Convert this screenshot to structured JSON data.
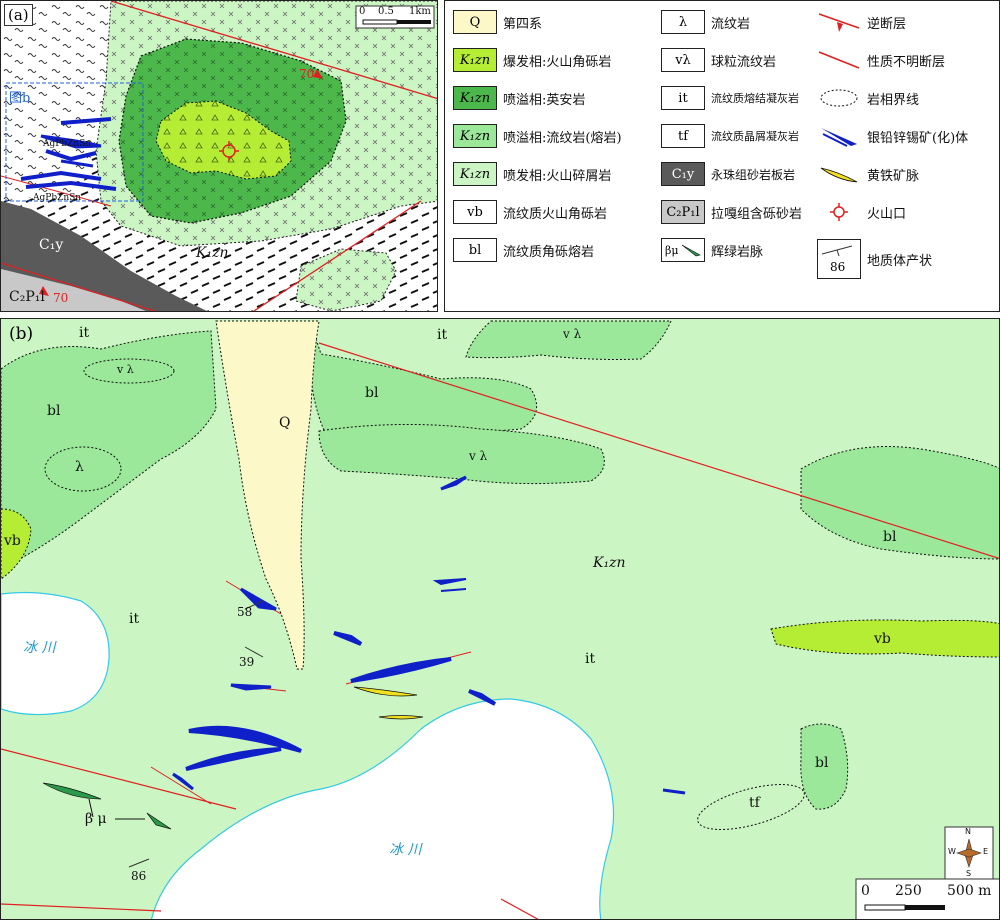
{
  "map_a": {
    "panel_label": "(a)",
    "scale": {
      "ticks": [
        "0",
        "0.5",
        "1km"
      ]
    },
    "inset_label": "图b",
    "labels": {
      "unit": "K₁zn",
      "c1y": "C₁y",
      "c2p1l": "C₂P₁l",
      "ore1": "AgPbZnSn",
      "ore2": "AgPbZnSn",
      "dip1": "70",
      "dip2": "70"
    }
  },
  "legend": {
    "items": [
      {
        "code": "Q",
        "text": "第四系",
        "fill": "#fdf8c8"
      },
      {
        "code": "K₁zn",
        "text": "爆发相:火山角砾岩",
        "fill": "#b5ed35"
      },
      {
        "code": "K₁zn",
        "text": "喷溢相:英安岩",
        "fill": "#4cb84c"
      },
      {
        "code": "K₁zn",
        "text": "喷溢相:流纹岩(熔岩)",
        "fill": "#9be89b"
      },
      {
        "code": "K₁zn",
        "text": "喷发相:火山碎屑岩",
        "fill": "#ccf5c4"
      },
      {
        "code": "vb",
        "text": "流纹质火山角砾岩",
        "fill": "#ffffff"
      },
      {
        "code": "bl",
        "text": "流纹质角砾熔岩",
        "fill": "#ffffff"
      },
      {
        "code": "λ",
        "text": "流纹岩",
        "fill": "#ffffff"
      },
      {
        "code": "vλ",
        "text": "球粒流纹岩",
        "fill": "#ffffff"
      },
      {
        "code": "it",
        "text": "流纹质熔结凝灰岩",
        "fill": "#ffffff"
      },
      {
        "code": "tf",
        "text": "流纹质晶屑凝灰岩",
        "fill": "#ffffff"
      },
      {
        "code": "C₁y",
        "text": "永珠组砂岩板岩",
        "fill": "#5a5a5a"
      },
      {
        "code": "C₂P₁l",
        "text": "拉嘎组含砾砂岩",
        "fill": "#c8c8c8"
      },
      {
        "code": "βμ",
        "text": "辉绿岩脉",
        "fill": "#ffffff"
      },
      {
        "code": "",
        "text": "逆断层",
        "fill": "#ffffff"
      },
      {
        "code": "",
        "text": "性质不明断层",
        "fill": "#ffffff"
      },
      {
        "code": "",
        "text": "岩相界线",
        "fill": "#ffffff"
      },
      {
        "code": "",
        "text": "银铅锌锡矿(化)体",
        "fill": "#ffffff"
      },
      {
        "code": "",
        "text": "黄铁矿脉",
        "fill": "#ffffff"
      },
      {
        "code": "",
        "text": "火山口",
        "fill": "#ffffff"
      },
      {
        "code": "86",
        "text": "地质体产状",
        "fill": "#ffffff"
      }
    ]
  },
  "map_b": {
    "panel_label": "(b)",
    "labels": {
      "it1": "it",
      "it2": "it",
      "it3": "it",
      "it4": "it",
      "bl1": "bl",
      "bl2": "bl",
      "bl3": "bl",
      "bl4": "bl",
      "vl1": "v λ",
      "vl2": "v λ",
      "vl3": "v λ",
      "lambda": "λ",
      "vb1": "vb",
      "vb2": "vb",
      "q": "Q",
      "unit": "K₁zn",
      "tf": "tf",
      "glacier1": "冰 川",
      "glacier2": "冰 川",
      "bm": "β μ",
      "dip58": "58",
      "dip39": "39",
      "dip86": "86"
    },
    "scale": {
      "ticks": [
        "0",
        "250",
        "500 m"
      ]
    },
    "compass": {
      "n": "N",
      "s": "S",
      "e": "E",
      "w": "W"
    }
  },
  "colors": {
    "pyroclastic": "#ccf5c4",
    "rhyolite": "#9be89b",
    "dacite": "#4cb84c",
    "breccia": "#b5ed35",
    "quaternary": "#fdf8c8",
    "fault": "#e02020",
    "ore": "#1020c8",
    "pyrite": "#f0e020",
    "diabase": "#2a9a4a",
    "glacier_edge": "#35c8e8",
    "c1y": "#5a5a5a",
    "c2p1l": "#c8c8c8"
  }
}
